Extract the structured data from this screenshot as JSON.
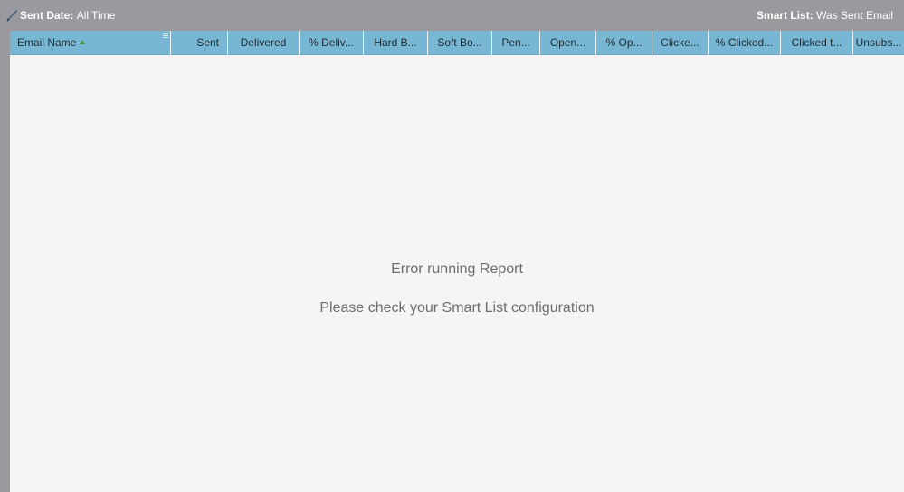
{
  "filters": {
    "sent_date_label": "Sent Date:",
    "sent_date_value": "All Time",
    "smart_list_label": "Smart List:",
    "smart_list_value": "Was Sent Email",
    "icon": "wrench-icon"
  },
  "columns": [
    "Email Name",
    "Sent",
    "Delivered",
    "% Deliv...",
    "Hard B...",
    "Soft Bo...",
    "Pen...",
    "Open...",
    "% Op...",
    "Clicke...",
    "% Clicked...",
    "Clicked t...",
    "Unsubs..."
  ],
  "sort": {
    "column": "Email Name",
    "direction": "ascending",
    "icon": "sort-asc-icon"
  },
  "message": {
    "title": "Error running Report",
    "detail": "Please check your Smart List configuration"
  },
  "colors": {
    "header_bg": "#78b7d3",
    "toolbar_bg": "#9a999e",
    "grid_bg": "#f5f5f5",
    "sort_icon": "#3d9a2f"
  }
}
